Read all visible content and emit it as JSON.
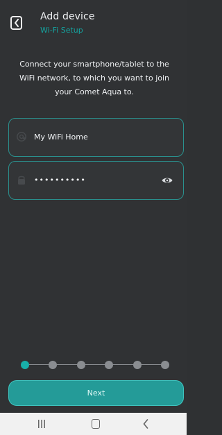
{
  "header": {
    "title": "Add device",
    "subtitle": "Wi-Fi Setup"
  },
  "instruction": "Connect your smartphone/tablet to the WiFi network, to which you want to join your Comet Aqua to.",
  "form": {
    "ssid": {
      "value": "My WiFi Home",
      "icon": "at-icon"
    },
    "password": {
      "value": "••••••••••",
      "icon": "lock-icon",
      "visibility_icon": "eye-icon"
    }
  },
  "steps": {
    "total": 6,
    "current": 1
  },
  "next_button": "Next",
  "colors": {
    "background": "#303234",
    "accent": "#18b0aa",
    "border": "#2a918e",
    "button": "#249b98"
  }
}
